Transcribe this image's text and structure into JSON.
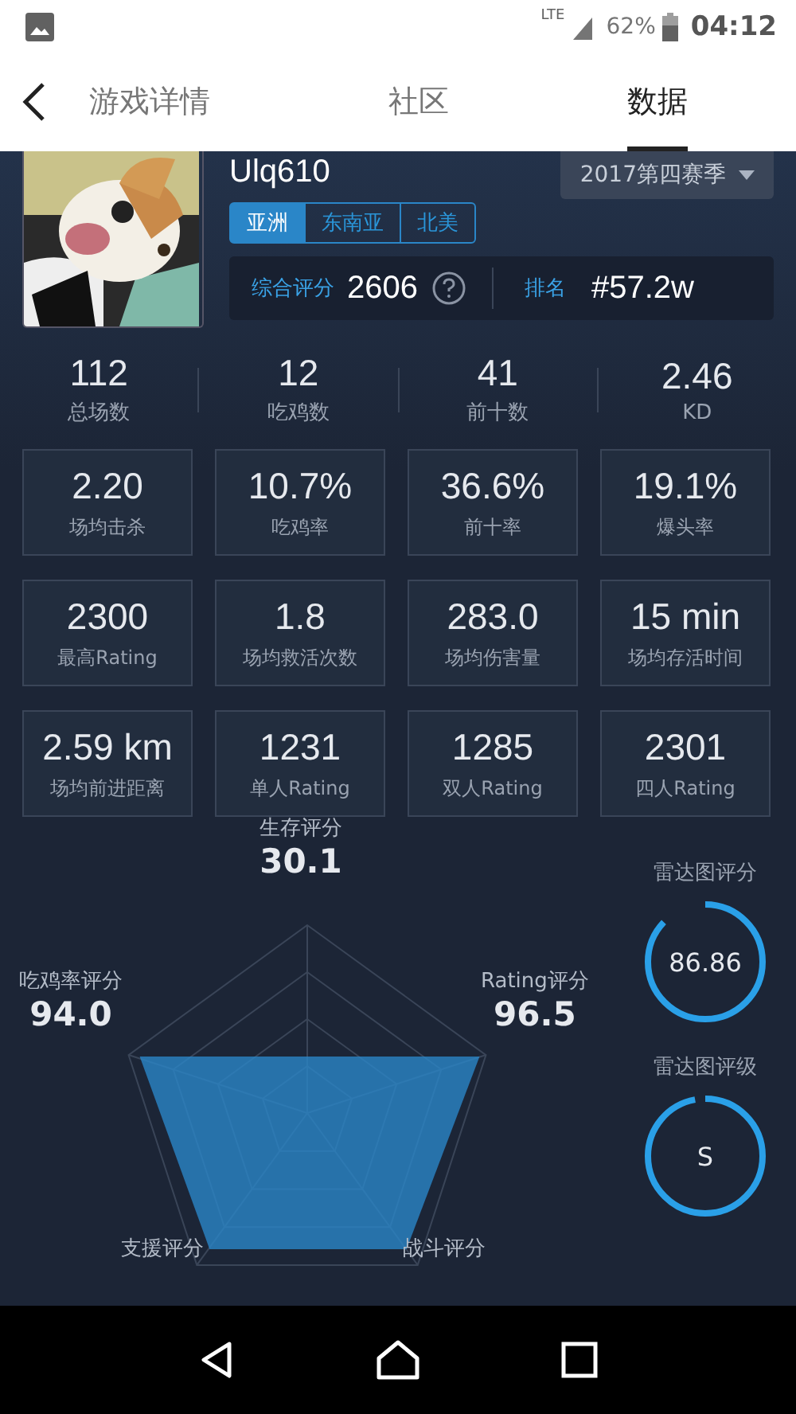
{
  "status_bar": {
    "battery": "62%",
    "time": "04:12",
    "network": "LTE"
  },
  "tabs": [
    {
      "label": "游戏详情",
      "selected": false
    },
    {
      "label": "社区",
      "selected": false
    },
    {
      "label": "数据",
      "selected": true
    }
  ],
  "profile": {
    "name": "Ulq610",
    "season": "2017第四赛季",
    "regions": [
      {
        "label": "亚洲",
        "selected": true
      },
      {
        "label": "东南亚",
        "selected": false
      },
      {
        "label": "北美",
        "selected": false
      }
    ],
    "score_label": "综合评分",
    "score": "2606",
    "rank_label": "排名",
    "rank": "#57.2w"
  },
  "summary": [
    {
      "value": "112",
      "label": "总场数"
    },
    {
      "value": "12",
      "label": "吃鸡数"
    },
    {
      "value": "41",
      "label": "前十数"
    },
    {
      "value": "2.46",
      "label": "KD"
    }
  ],
  "stats": [
    {
      "value": "2.20",
      "label": "场均击杀"
    },
    {
      "value": "10.7%",
      "label": "吃鸡率"
    },
    {
      "value": "36.6%",
      "label": "前十率"
    },
    {
      "value": "19.1%",
      "label": "爆头率"
    },
    {
      "value": "2300",
      "label": "最高Rating"
    },
    {
      "value": "1.8",
      "label": "场均救活次数"
    },
    {
      "value": "283.0",
      "label": "场均伤害量"
    },
    {
      "value": "15 min",
      "label": "场均存活时间"
    },
    {
      "value": "2.59 km",
      "label": "场均前进距离"
    },
    {
      "value": "1231",
      "label": "单人Rating"
    },
    {
      "value": "1285",
      "label": "双人Rating"
    },
    {
      "value": "2301",
      "label": "四人Rating"
    }
  ],
  "radar": {
    "axes": [
      {
        "label": "生存评分",
        "value": "30.1"
      },
      {
        "label": "Rating评分",
        "value": "96.5"
      },
      {
        "label": "战斗评分"
      },
      {
        "label": "支援评分"
      },
      {
        "label": "吃鸡率评分",
        "value": "94.0"
      }
    ]
  },
  "gauges": [
    {
      "title": "雷达图评分",
      "text": "86.86",
      "level": 0.87
    },
    {
      "title": "雷达图评级",
      "text": "S",
      "level": 0.97
    }
  ]
}
